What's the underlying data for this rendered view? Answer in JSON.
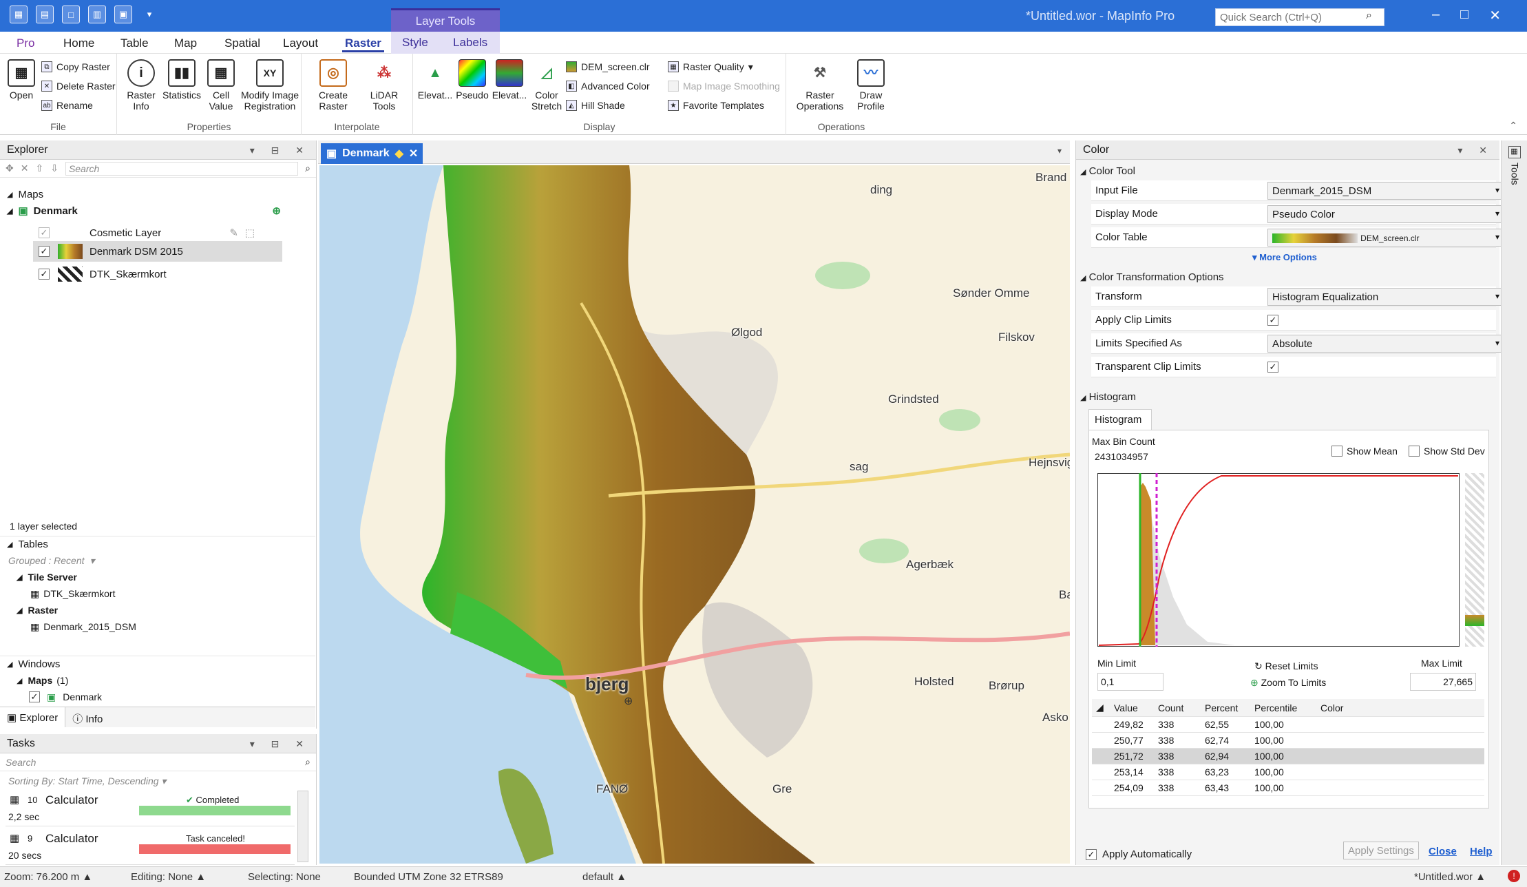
{
  "app": {
    "window_title": "*Untitled.wor - MapInfo Pro",
    "quick_search_placeholder": "Quick Search (Ctrl+Q)",
    "contextual_tab_group": "Layer Tools"
  },
  "menu_tabs": [
    "Pro",
    "Home",
    "Table",
    "Map",
    "Spatial",
    "Layout",
    "Raster",
    "Style",
    "Labels"
  ],
  "ribbon": {
    "file": {
      "label": "File",
      "open": "Open",
      "copy_raster": "Copy Raster",
      "delete_raster": "Delete Raster",
      "rename": "Rename"
    },
    "properties": {
      "label": "Properties",
      "raster_info": "Raster Info",
      "statistics": "Statistics",
      "cell_value": "Cell Value",
      "modify_image": "Modify Image Registration"
    },
    "interpolate": {
      "label": "Interpolate",
      "create_raster": "Create Raster",
      "lidar_tools": "LiDAR Tools"
    },
    "display": {
      "label": "Display",
      "elevat1": "Elevat...",
      "pseudo": "Pseudo",
      "elevat2": "Elevat...",
      "color_stretch": "Color Stretch",
      "dem_screen": "DEM_screen.clr",
      "advanced_color": "Advanced Color",
      "hill_shade": "Hill Shade",
      "raster_quality": "Raster Quality",
      "map_image_smoothing": "Map Image Smoothing",
      "favorite_templates": "Favorite Templates"
    },
    "operations": {
      "label": "Operations",
      "raster_operations": "Raster Operations",
      "draw_profile": "Draw Profile"
    }
  },
  "explorer": {
    "title": "Explorer",
    "search_placeholder": "Search",
    "maps_heading": "Maps",
    "map_name": "Denmark",
    "layers": [
      "Cosmetic Layer",
      "Denmark DSM 2015",
      "DTK_Skærmkort"
    ],
    "selection_status": "1 layer selected",
    "tables_heading": "Tables",
    "grouped": "Grouped : Recent",
    "tile_server": "Tile Server",
    "tile_server_item": "DTK_Skærmkort",
    "raster": "Raster",
    "raster_item": "Denmark_2015_DSM",
    "windows_heading": "Windows",
    "windows_maps": "Maps",
    "windows_maps_count": "(1)",
    "windows_item": "Denmark",
    "tab_explorer": "Explorer",
    "tab_info": "Info"
  },
  "tasks": {
    "title": "Tasks",
    "search_placeholder": "Search",
    "sorting": "Sorting By: Start Time, Descending",
    "items": [
      {
        "id": "10",
        "name": "Calculator",
        "status": "Completed",
        "time": "2,2 sec",
        "color": "#8ed98e"
      },
      {
        "id": "9",
        "name": "Calculator",
        "status": "Task canceled!",
        "time": "20 secs",
        "color": "#f06a6a"
      }
    ]
  },
  "map": {
    "tab_label": "Denmark",
    "labels": [
      "Brand",
      "ding",
      "Sønder Omme",
      "Ølgod",
      "Filskov",
      "Grindsted",
      "Hejnsvig",
      "sag",
      "Agerbæk",
      "Holsted",
      "Brørup",
      "Asko",
      "bjerg",
      "FANØ",
      "Gre",
      "Ba"
    ]
  },
  "color_panel": {
    "title": "Color",
    "color_tool": "Color Tool",
    "input_file_label": "Input File",
    "input_file": "Denmark_2015_DSM",
    "display_mode_label": "Display Mode",
    "display_mode": "Pseudo Color",
    "color_table_label": "Color Table",
    "color_table": "DEM_screen.clr",
    "more_options": "More Options",
    "transform_section": "Color Transformation Options",
    "transform_label": "Transform",
    "transform": "Histogram Equalization",
    "apply_clip_label": "Apply Clip Limits",
    "limits_as_label": "Limits Specified As",
    "limits_as": "Absolute",
    "transparent_clip_label": "Transparent Clip Limits",
    "histogram_section": "Histogram",
    "histogram_tab": "Histogram",
    "max_bin_label": "Max Bin Count",
    "max_bin": "2431034957",
    "show_mean": "Show Mean",
    "show_std": "Show Std Dev",
    "min_limit_label": "Min Limit",
    "min_limit": "0,1",
    "max_limit_label": "Max Limit",
    "max_limit": "27,665",
    "reset_limits": "Reset Limits",
    "zoom_to_limits": "Zoom To Limits",
    "table_headers": [
      "Value",
      "Count",
      "Percent",
      "Percentile",
      "Color"
    ],
    "table_rows": [
      [
        "249,82",
        "338",
        "62,55",
        "100,00"
      ],
      [
        "250,77",
        "338",
        "62,74",
        "100,00"
      ],
      [
        "251,72",
        "338",
        "62,94",
        "100,00"
      ],
      [
        "253,14",
        "338",
        "63,23",
        "100,00"
      ],
      [
        "254,09",
        "338",
        "63,43",
        "100,00"
      ]
    ],
    "apply_automatically": "Apply Automatically",
    "apply_settings": "Apply Settings",
    "close": "Close",
    "help": "Help"
  },
  "tools_strip": "Tools",
  "status_bar": {
    "zoom": "Zoom: 76.200 m",
    "editing": "Editing: None",
    "selecting": "Selecting: None",
    "projection": "Bounded UTM Zone 32 ETRS89",
    "style": "default",
    "workspace": "*Untitled.wor"
  },
  "colors": {
    "accent": "#2b6fd6",
    "contextual": "#6d62c9"
  }
}
